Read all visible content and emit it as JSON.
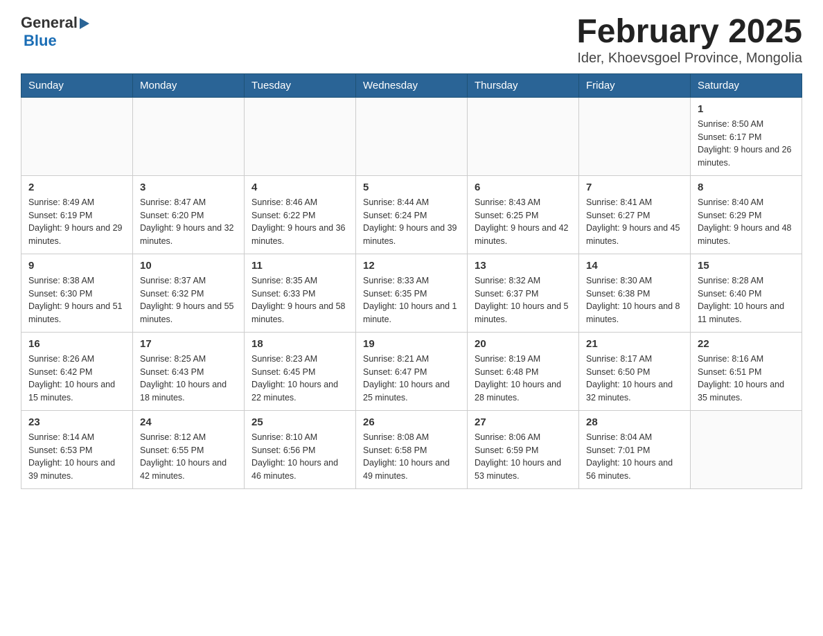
{
  "logo": {
    "general": "General",
    "blue": "Blue"
  },
  "title": "February 2025",
  "subtitle": "Ider, Khoevsgoel Province, Mongolia",
  "weekdays": [
    "Sunday",
    "Monday",
    "Tuesday",
    "Wednesday",
    "Thursday",
    "Friday",
    "Saturday"
  ],
  "weeks": [
    [
      {
        "day": "",
        "info": ""
      },
      {
        "day": "",
        "info": ""
      },
      {
        "day": "",
        "info": ""
      },
      {
        "day": "",
        "info": ""
      },
      {
        "day": "",
        "info": ""
      },
      {
        "day": "",
        "info": ""
      },
      {
        "day": "1",
        "info": "Sunrise: 8:50 AM\nSunset: 6:17 PM\nDaylight: 9 hours and 26 minutes."
      }
    ],
    [
      {
        "day": "2",
        "info": "Sunrise: 8:49 AM\nSunset: 6:19 PM\nDaylight: 9 hours and 29 minutes."
      },
      {
        "day": "3",
        "info": "Sunrise: 8:47 AM\nSunset: 6:20 PM\nDaylight: 9 hours and 32 minutes."
      },
      {
        "day": "4",
        "info": "Sunrise: 8:46 AM\nSunset: 6:22 PM\nDaylight: 9 hours and 36 minutes."
      },
      {
        "day": "5",
        "info": "Sunrise: 8:44 AM\nSunset: 6:24 PM\nDaylight: 9 hours and 39 minutes."
      },
      {
        "day": "6",
        "info": "Sunrise: 8:43 AM\nSunset: 6:25 PM\nDaylight: 9 hours and 42 minutes."
      },
      {
        "day": "7",
        "info": "Sunrise: 8:41 AM\nSunset: 6:27 PM\nDaylight: 9 hours and 45 minutes."
      },
      {
        "day": "8",
        "info": "Sunrise: 8:40 AM\nSunset: 6:29 PM\nDaylight: 9 hours and 48 minutes."
      }
    ],
    [
      {
        "day": "9",
        "info": "Sunrise: 8:38 AM\nSunset: 6:30 PM\nDaylight: 9 hours and 51 minutes."
      },
      {
        "day": "10",
        "info": "Sunrise: 8:37 AM\nSunset: 6:32 PM\nDaylight: 9 hours and 55 minutes."
      },
      {
        "day": "11",
        "info": "Sunrise: 8:35 AM\nSunset: 6:33 PM\nDaylight: 9 hours and 58 minutes."
      },
      {
        "day": "12",
        "info": "Sunrise: 8:33 AM\nSunset: 6:35 PM\nDaylight: 10 hours and 1 minute."
      },
      {
        "day": "13",
        "info": "Sunrise: 8:32 AM\nSunset: 6:37 PM\nDaylight: 10 hours and 5 minutes."
      },
      {
        "day": "14",
        "info": "Sunrise: 8:30 AM\nSunset: 6:38 PM\nDaylight: 10 hours and 8 minutes."
      },
      {
        "day": "15",
        "info": "Sunrise: 8:28 AM\nSunset: 6:40 PM\nDaylight: 10 hours and 11 minutes."
      }
    ],
    [
      {
        "day": "16",
        "info": "Sunrise: 8:26 AM\nSunset: 6:42 PM\nDaylight: 10 hours and 15 minutes."
      },
      {
        "day": "17",
        "info": "Sunrise: 8:25 AM\nSunset: 6:43 PM\nDaylight: 10 hours and 18 minutes."
      },
      {
        "day": "18",
        "info": "Sunrise: 8:23 AM\nSunset: 6:45 PM\nDaylight: 10 hours and 22 minutes."
      },
      {
        "day": "19",
        "info": "Sunrise: 8:21 AM\nSunset: 6:47 PM\nDaylight: 10 hours and 25 minutes."
      },
      {
        "day": "20",
        "info": "Sunrise: 8:19 AM\nSunset: 6:48 PM\nDaylight: 10 hours and 28 minutes."
      },
      {
        "day": "21",
        "info": "Sunrise: 8:17 AM\nSunset: 6:50 PM\nDaylight: 10 hours and 32 minutes."
      },
      {
        "day": "22",
        "info": "Sunrise: 8:16 AM\nSunset: 6:51 PM\nDaylight: 10 hours and 35 minutes."
      }
    ],
    [
      {
        "day": "23",
        "info": "Sunrise: 8:14 AM\nSunset: 6:53 PM\nDaylight: 10 hours and 39 minutes."
      },
      {
        "day": "24",
        "info": "Sunrise: 8:12 AM\nSunset: 6:55 PM\nDaylight: 10 hours and 42 minutes."
      },
      {
        "day": "25",
        "info": "Sunrise: 8:10 AM\nSunset: 6:56 PM\nDaylight: 10 hours and 46 minutes."
      },
      {
        "day": "26",
        "info": "Sunrise: 8:08 AM\nSunset: 6:58 PM\nDaylight: 10 hours and 49 minutes."
      },
      {
        "day": "27",
        "info": "Sunrise: 8:06 AM\nSunset: 6:59 PM\nDaylight: 10 hours and 53 minutes."
      },
      {
        "day": "28",
        "info": "Sunrise: 8:04 AM\nSunset: 7:01 PM\nDaylight: 10 hours and 56 minutes."
      },
      {
        "day": "",
        "info": ""
      }
    ]
  ]
}
